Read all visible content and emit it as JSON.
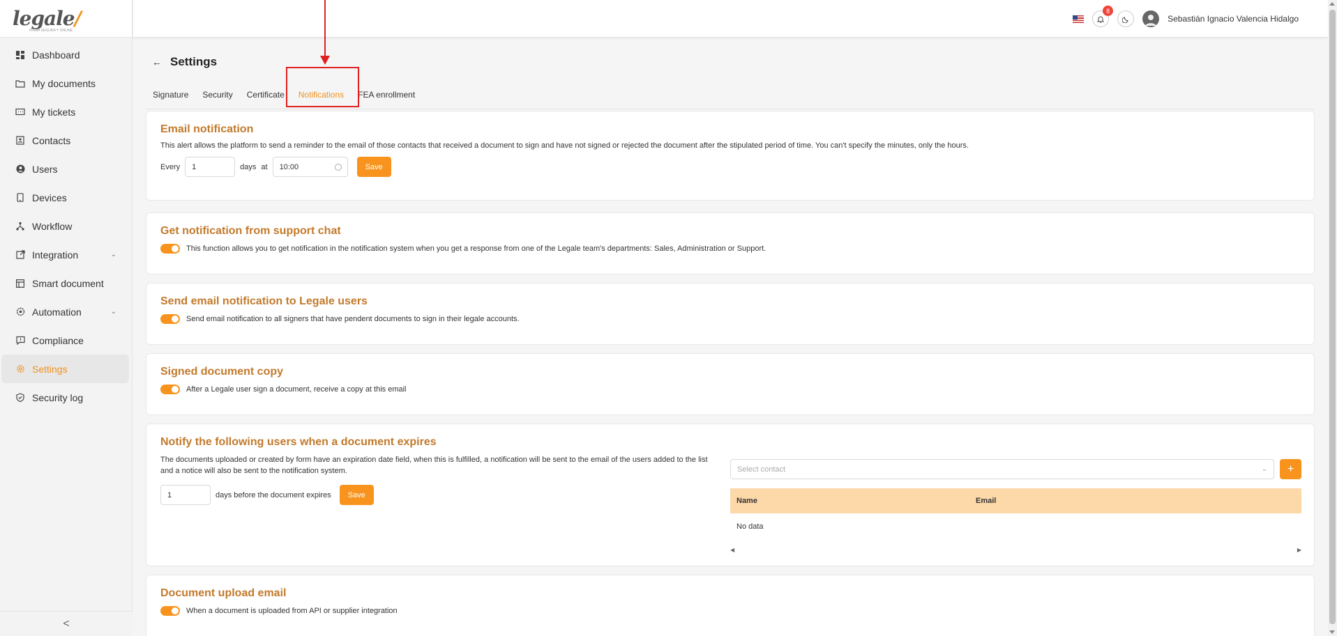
{
  "app": {
    "logo_text": "legale",
    "logo_mark": "/",
    "logo_tagline": "FIRMA SEGURA Y ONLINE"
  },
  "sidebar": {
    "items": [
      {
        "label": "Dashboard",
        "icon": "dashboard-icon"
      },
      {
        "label": "My documents",
        "icon": "folder-icon"
      },
      {
        "label": "My tickets",
        "icon": "ticket-icon"
      },
      {
        "label": "Contacts",
        "icon": "contacts-icon"
      },
      {
        "label": "Users",
        "icon": "user-icon"
      },
      {
        "label": "Devices",
        "icon": "device-icon"
      },
      {
        "label": "Workflow",
        "icon": "workflow-icon"
      },
      {
        "label": "Integration",
        "icon": "integration-icon",
        "expandable": true
      },
      {
        "label": "Smart document",
        "icon": "smart-document-icon"
      },
      {
        "label": "Automation",
        "icon": "automation-icon",
        "expandable": true
      },
      {
        "label": "Compliance",
        "icon": "compliance-icon"
      },
      {
        "label": "Settings",
        "icon": "settings-icon",
        "active": true
      },
      {
        "label": "Security log",
        "icon": "shield-icon"
      }
    ],
    "collapse_glyph": "<"
  },
  "topbar": {
    "notification_count": "8",
    "user_name": "Sebastián Ignacio Valencia Hidalgo"
  },
  "page": {
    "title": "Settings",
    "tabs": [
      {
        "label": "Signature"
      },
      {
        "label": "Security"
      },
      {
        "label": "Certificate"
      },
      {
        "label": "Notifications",
        "active": true
      },
      {
        "label": "FEA enrollment"
      }
    ]
  },
  "email_notification": {
    "title": "Email notification",
    "description": "This alert allows the platform to send a reminder to the email of those contacts that received a document to sign and have not signed or rejected the document after the stipulated period of time. You can't specify the minutes, only the hours.",
    "every_label": "Every",
    "days_value": "1",
    "days_label": "days",
    "at_label": "at",
    "time_value": "10:00",
    "save_label": "Save"
  },
  "support_chat": {
    "title": "Get notification from support chat",
    "toggle_text": "This function allows you to get notification in the notification system when you get a response from one of the Legale team's departments: Sales, Administration or Support.",
    "enabled": true
  },
  "legale_users": {
    "title": "Send email notification to Legale users",
    "toggle_text": "Send email notification to all signers that have pendent documents to sign in their legale accounts.",
    "enabled": true
  },
  "signed_copy": {
    "title": "Signed document copy",
    "toggle_text": "After a Legale user sign a document, receive a copy at this email",
    "enabled": true
  },
  "expiry": {
    "title": "Notify the following users when a document expires",
    "description": "The documents uploaded or created by form have an expiration date field, when this is fulfilled, a notification will be sent to the email of the users added to the list and a notice will also be sent to the notification system.",
    "days_value": "1",
    "days_label": "days before the document expires",
    "save_label": "Save",
    "select_placeholder": "Select contact",
    "add_glyph": "+",
    "columns": [
      "Name",
      "Email"
    ],
    "empty_text": "No data"
  },
  "upload_email": {
    "title": "Document upload email",
    "toggle_text": "When a document is uploaded from API or supplier integration",
    "enabled": true
  },
  "colors": {
    "accent": "#f8941d",
    "title": "#c27a2c",
    "table_header": "#fdd8a8",
    "annotation": "#e02020"
  }
}
